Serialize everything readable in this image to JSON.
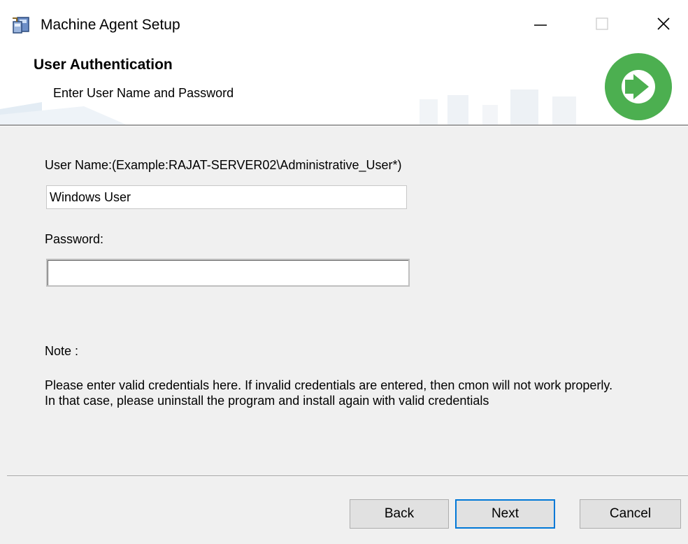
{
  "window": {
    "title": "Machine Agent Setup",
    "icon": "installer-icon",
    "controls": {
      "minimize_icon": "minimize-icon",
      "maximize_icon": "maximize-icon",
      "close_icon": "close-icon"
    }
  },
  "header": {
    "title": "User Authentication",
    "subtitle": "Enter User Name and Password",
    "logo_icon": "green-arrow-logo-icon",
    "logo_color": "#4caf50"
  },
  "form": {
    "username_label": "User Name:(Example:RAJAT-SERVER02\\Administrative_User*)",
    "username_value": "Windows User",
    "password_label": "Password:",
    "password_value": ""
  },
  "note": {
    "label": "Note :",
    "text": "Please enter valid credentials here. If invalid credentials are entered, then cmon will not work properly. In that case, please uninstall the program and install again with valid credentials"
  },
  "buttons": {
    "back": "Back",
    "next": "Next",
    "cancel": "Cancel"
  },
  "colors": {
    "focus_border": "#0078d7",
    "dialog_background": "#f0f0f0"
  }
}
